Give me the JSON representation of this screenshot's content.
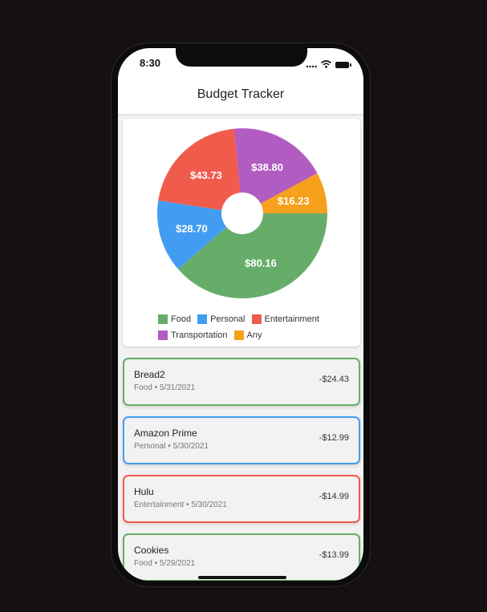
{
  "status": {
    "time": "8:30"
  },
  "app_bar": {
    "title": "Budget Tracker"
  },
  "chart_data": {
    "type": "pie",
    "slices": [
      {
        "category": "Food",
        "label": "$80.16",
        "value": 80.16,
        "color": "#66ad6a"
      },
      {
        "category": "Personal",
        "label": "$28.70",
        "value": 28.7,
        "color": "#429df2"
      },
      {
        "category": "Entertainment",
        "label": "$43.73",
        "value": 43.73,
        "color": "#f15b4c"
      },
      {
        "category": "Transportation",
        "label": "$38.80",
        "value": 38.8,
        "color": "#b05cc1"
      },
      {
        "category": "Any",
        "label": "$16.23",
        "value": 16.23,
        "color": "#f6a01b"
      }
    ],
    "legend": [
      "Food",
      "Personal",
      "Entertainment",
      "Transportation",
      "Any"
    ],
    "legend_position": "bottom"
  },
  "transactions": [
    {
      "name": "Bread2",
      "category": "Food",
      "date": "5/31/2021",
      "amount": "-$24.43",
      "color": "#66ad6a"
    },
    {
      "name": "Amazon Prime",
      "category": "Personal",
      "date": "5/30/2021",
      "amount": "-$12.99",
      "color": "#429df2"
    },
    {
      "name": "Hulu",
      "category": "Entertainment",
      "date": "5/30/2021",
      "amount": "-$14.99",
      "color": "#f15b4c"
    },
    {
      "name": "Cookies",
      "category": "Food",
      "date": "5/29/2021",
      "amount": "-$13.99",
      "color": "#66ad6a"
    }
  ]
}
